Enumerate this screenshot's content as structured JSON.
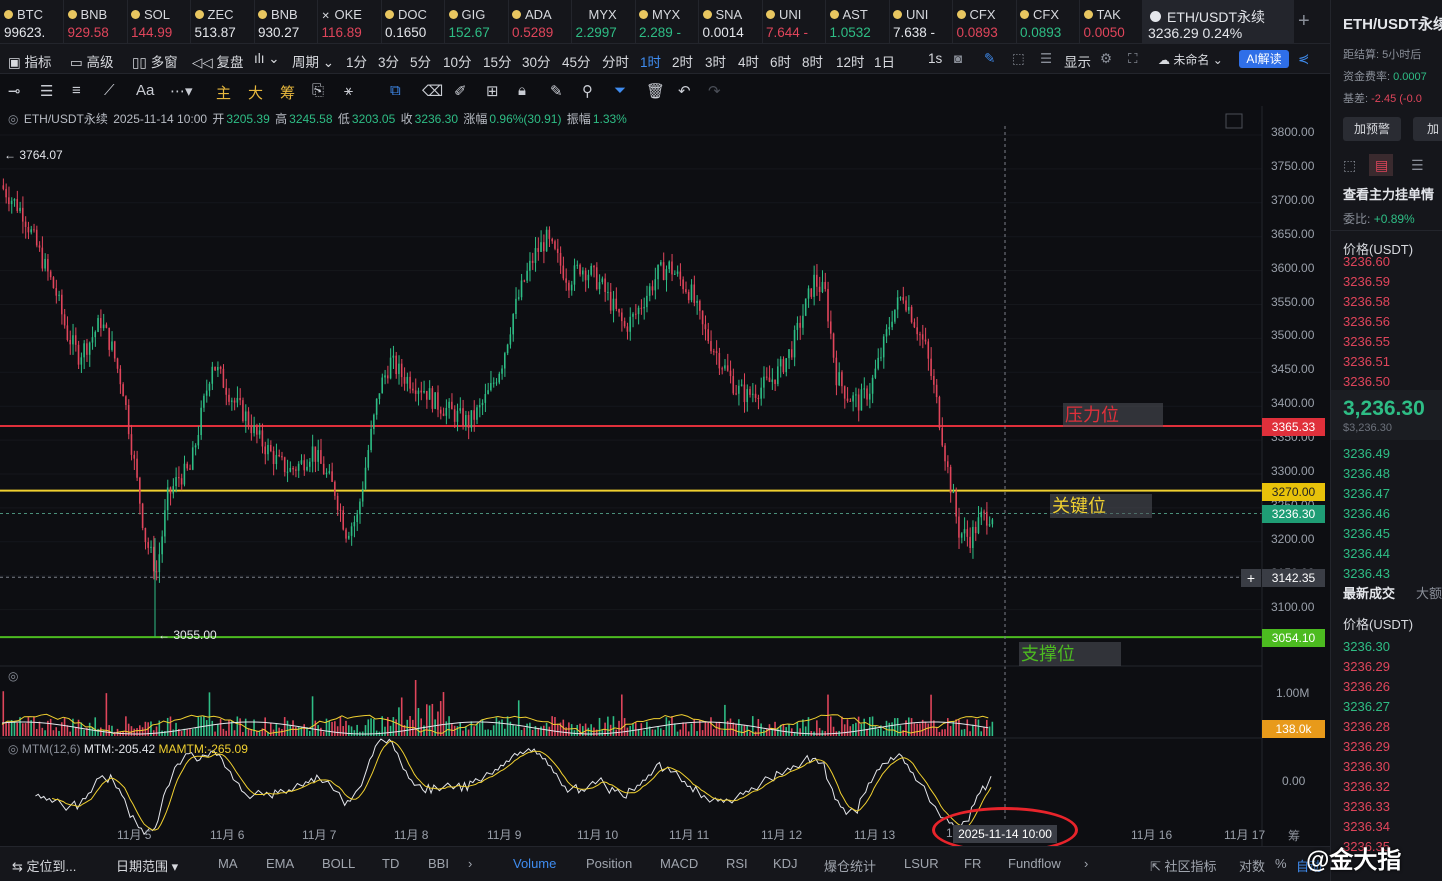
{
  "tickers": [
    {
      "name": "BTC",
      "price": "99623.",
      "dir": "wh",
      "icon": "dot-icon"
    },
    {
      "name": "BNB",
      "price": "929.58",
      "dir": "dn",
      "icon": "dot-icon"
    },
    {
      "name": "SOL",
      "price": "144.99",
      "dir": "dn",
      "icon": "dot-icon"
    },
    {
      "name": "ZEC",
      "price": "513.87",
      "dir": "wh",
      "icon": "dot-icon"
    },
    {
      "name": "BNB",
      "price": "930.27",
      "dir": "wh",
      "icon": "dot-icon"
    },
    {
      "name": "OKE",
      "price": "116.89",
      "dir": "dn",
      "icon": "x-icon"
    },
    {
      "name": "DOC",
      "price": "0.1650",
      "dir": "wh",
      "icon": "dot-icon"
    },
    {
      "name": "GIG",
      "price": "152.67",
      "dir": "up",
      "icon": "dot-icon"
    },
    {
      "name": "ADA",
      "price": "0.5289",
      "dir": "dn",
      "icon": "dot-icon"
    },
    {
      "name": "MYX",
      "price": "2.2997",
      "dir": "up",
      "icon": "none"
    },
    {
      "name": "MYX",
      "price": "2.289 -",
      "dir": "up",
      "icon": "dot-icon"
    },
    {
      "name": "SNA",
      "price": "0.0014",
      "dir": "wh",
      "icon": "dot-icon"
    },
    {
      "name": "UNI",
      "price": "7.644 -",
      "dir": "dn",
      "icon": "dot-icon"
    },
    {
      "name": "AST",
      "price": "1.0532",
      "dir": "up",
      "icon": "dot-icon"
    },
    {
      "name": "UNI",
      "price": "7.638 -",
      "dir": "wh",
      "icon": "dot-icon"
    },
    {
      "name": "CFX",
      "price": "0.0893",
      "dir": "dn",
      "icon": "dot-icon"
    },
    {
      "name": "CFX",
      "price": "0.0893",
      "dir": "up",
      "icon": "dot-icon"
    },
    {
      "name": "TAK",
      "price": "0.0050",
      "dir": "dn",
      "icon": "dot-icon"
    }
  ],
  "active_ticker": {
    "name": "ETH/USDT永续",
    "price": "3236.29",
    "change": "0.24%"
  },
  "toolbar1": {
    "indicators": "指标",
    "advanced": "高级",
    "multi": "多窗",
    "replay": "复盘",
    "period": "周期",
    "intervals": [
      "1分",
      "3分",
      "5分",
      "10分",
      "15分",
      "30分",
      "45分",
      "分时",
      "1时",
      "2时",
      "3时",
      "4时",
      "6时",
      "8时",
      "12时",
      "1日"
    ],
    "active_interval": "1时",
    "seconds": "1s",
    "display": "显示",
    "unnamed": "未命名",
    "ai": "AI解读"
  },
  "toolbar2": {
    "main": "主",
    "big": "大",
    "chip": "筹",
    "text": "Aa"
  },
  "ohlc": {
    "symbol": "ETH/USDT永续",
    "time": "2025-11-14 10:00",
    "open_label": "开",
    "open": "3205.39",
    "high_label": "高",
    "high": "3245.58",
    "low_label": "低",
    "low": "3203.05",
    "close_label": "收",
    "close": "3236.30",
    "chg_label": "涨幅",
    "chg": "0.96%(30.91)",
    "amp_label": "振幅",
    "amp": "1.33%"
  },
  "price_axis": [
    "3800.00",
    "3750.00",
    "3700.00",
    "3650.00",
    "3600.00",
    "3550.00",
    "3500.00",
    "3450.00",
    "3400.00",
    "3350.00",
    "3300.00",
    "3250.00",
    "3200.00",
    "3150.00",
    "3100.00"
  ],
  "price_tags": {
    "resistance": "3365.33",
    "key": "3270.00",
    "last": "3236.30",
    "cursor": "3142.35",
    "support": "3054.10",
    "volume": "138.0k"
  },
  "zones": {
    "resistance": "压力位",
    "key": "关键位",
    "support": "支撑位"
  },
  "markers": {
    "high": "3764.07",
    "low": "3055.00"
  },
  "volume_axis": "1.00M",
  "mtm": {
    "label": "MTM(12,6)",
    "mtm": "MTM:-205.42",
    "mamtm": "MAMTM:-265.09",
    "zero": "0.00"
  },
  "time_axis": [
    "11月 5",
    "11月 6",
    "11月 7",
    "11月 8",
    "11月 9",
    "11月 10",
    "11月 11",
    "11月 12",
    "11月 13",
    "1",
    "11月 16",
    "11月 17"
  ],
  "time_tip": "2025-11-14 10:00",
  "time_axis_extra": "筹",
  "bottom": {
    "locate": "定位到...",
    "range": "日期范围",
    "items": [
      "MA",
      "EMA",
      "BOLL",
      "TD",
      "BBI",
      "Volume",
      "Position",
      "MACD",
      "RSI",
      "KDJ",
      "爆仓统计",
      "LSUR",
      "FR",
      "Fundflow"
    ],
    "active": "Volume",
    "community": "社区指标",
    "log": "对数",
    "pct": "%",
    "auto": "自动"
  },
  "right_panel": {
    "title": "ETH/USDT永续",
    "settle_label": "距结算:",
    "settle": "5小时后",
    "funding_label": "资金费率:",
    "funding": "0.0007",
    "basis_label": "基差:",
    "basis": "-2.45 (-0.0",
    "alert_btn": "加预警",
    "add_btn": "加",
    "big_orders": "查看主力挂单情",
    "ratio_label": "委比:",
    "ratio": "+0.89%",
    "price_header": "价格(USDT)",
    "asks": [
      "3236.60",
      "3236.59",
      "3236.58",
      "3236.56",
      "3236.55",
      "3236.51",
      "3236.50"
    ],
    "mid_price": "3,236.30",
    "mid_sub": "$3,236.30",
    "bids": [
      "3236.49",
      "3236.48",
      "3236.47",
      "3236.46",
      "3236.45",
      "3236.44",
      "3236.43"
    ],
    "trades_title": "最新成交",
    "trades_tab2": "大额",
    "trades_header": "价格(USDT)",
    "trades": [
      {
        "p": "3236.30",
        "d": "up"
      },
      {
        "p": "3236.29",
        "d": "dn"
      },
      {
        "p": "3236.26",
        "d": "dn"
      },
      {
        "p": "3236.27",
        "d": "up"
      },
      {
        "p": "3236.28",
        "d": "dn"
      },
      {
        "p": "3236.29",
        "d": "dn"
      },
      {
        "p": "3236.30",
        "d": "dn"
      },
      {
        "p": "3236.32",
        "d": "dn"
      },
      {
        "p": "3236.33",
        "d": "dn"
      },
      {
        "p": "3236.34",
        "d": "dn"
      },
      {
        "p": "3236.35",
        "d": "dn"
      }
    ]
  },
  "watermark": "@金大指",
  "chart_data": {
    "type": "candlestick",
    "symbol": "ETH/USDT永续",
    "interval": "1时",
    "ylim": [
      3055,
      3800
    ],
    "x_labels": [
      "11月 5",
      "11月 6",
      "11月 7",
      "11月 8",
      "11月 9",
      "11月 10",
      "11月 11",
      "11月 12",
      "11月 13",
      "11月 14",
      "11月 16",
      "11月 17"
    ],
    "close_path": [
      3720,
      3700,
      3680,
      3640,
      3600,
      3560,
      3500,
      3470,
      3490,
      3520,
      3480,
      3420,
      3310,
      3200,
      3150,
      3260,
      3290,
      3300,
      3380,
      3460,
      3430,
      3400,
      3380,
      3350,
      3330,
      3310,
      3300,
      3310,
      3330,
      3300,
      3270,
      3210,
      3230,
      3330,
      3420,
      3460,
      3440,
      3430,
      3420,
      3400,
      3390,
      3380,
      3370,
      3390,
      3420,
      3460,
      3530,
      3580,
      3620,
      3640,
      3610,
      3580,
      3600,
      3590,
      3570,
      3540,
      3510,
      3530,
      3560,
      3590,
      3600,
      3580,
      3560,
      3510,
      3480,
      3450,
      3420,
      3410,
      3420,
      3430,
      3450,
      3480,
      3530,
      3580,
      3560,
      3440,
      3410,
      3400,
      3420,
      3470,
      3530,
      3560,
      3520,
      3480,
      3400,
      3300,
      3210,
      3200,
      3230,
      3236
    ],
    "horizontal_lines": [
      {
        "name": "压力位",
        "price": 3365.33,
        "color": "#e0303b"
      },
      {
        "name": "关键位",
        "price": 3270.0,
        "color": "#f0d030"
      },
      {
        "name": "支撑位",
        "price": 3054.1,
        "color": "#4cbb20"
      }
    ],
    "last_price": 3236.3,
    "high_marker": 3764.07,
    "low_marker": 3055.0,
    "volume_axis_label": "1.00M",
    "mtm": {
      "mtm": -205.42,
      "mamtm": -265.09
    }
  }
}
